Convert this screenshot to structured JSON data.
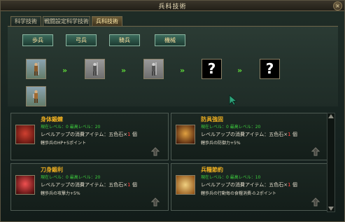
{
  "window": {
    "title": "兵科技術",
    "close": "×"
  },
  "tabs": [
    {
      "label": "科学技術",
      "active": false
    },
    {
      "label": "戦闘設定科学技術",
      "active": false
    },
    {
      "label": "兵科技術",
      "active": true
    }
  ],
  "unit_buttons": [
    "歩兵",
    "弓兵",
    "騎兵",
    "機械"
  ],
  "tree": {
    "locked_symbol": "?",
    "arrow": "»"
  },
  "cards": [
    {
      "name": "身体鍛錬",
      "level_line": "現在レベル：0  最高レベル：20",
      "material_prefix": "レベルアップの消費アイテム：五色石×",
      "material_count": "1",
      "material_suffix": " 個",
      "effect": "轄歩兵のHP+5ポイント"
    },
    {
      "name": "防具強固",
      "level_line": "現在レベル：0  最高レベル：20",
      "material_prefix": "レベルアップの消費アイテム：五色石×",
      "material_count": "1",
      "material_suffix": " 個",
      "effect": "轄歩兵の防御力+5%"
    },
    {
      "name": "刀身鍛利",
      "level_line": "現在レベル：0  最高レベル：20",
      "material_prefix": "レベルアップの消費アイテム：五色石×",
      "material_count": "1",
      "material_suffix": " 個",
      "effect": "轄歩兵の攻撃力+5%"
    },
    {
      "name": "兵糧節約",
      "level_line": "現在レベル：0  最高レベル：10",
      "material_prefix": "レベルアップの消費アイテム：五色石×",
      "material_count": "1",
      "material_suffix": " 個",
      "effect": "轄歩兵の行動毎の食糧消費-0.2ポイント"
    }
  ]
}
